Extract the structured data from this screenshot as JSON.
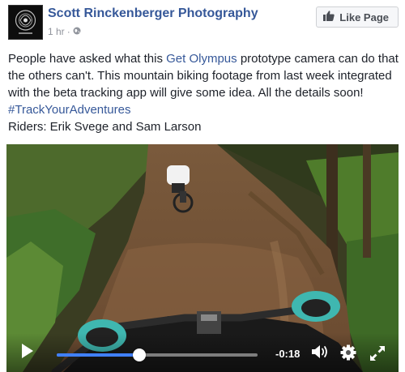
{
  "post": {
    "page_name": "Scott Rinckenberger Photography",
    "time_ago": "1 hr",
    "separator": "·",
    "like_page_label": "Like Page",
    "text_part1": "People have asked what this ",
    "link_text": "Get Olympus",
    "text_part2": " prototype camera can do that the others can't. This mountain biking footage from last week integrated with the beta tracking app will give some idea. All the details soon! ",
    "hashtag": "#TrackYourAdventures",
    "riders": "Riders: Erik Svege and Sam Larson"
  },
  "video": {
    "time_remaining": "-0:18",
    "progress": 0.41,
    "colors": {
      "progress": "#4080ff",
      "link": "#365899"
    },
    "icons": [
      "play-icon",
      "volume-icon",
      "settings-icon",
      "fullscreen-icon"
    ]
  }
}
